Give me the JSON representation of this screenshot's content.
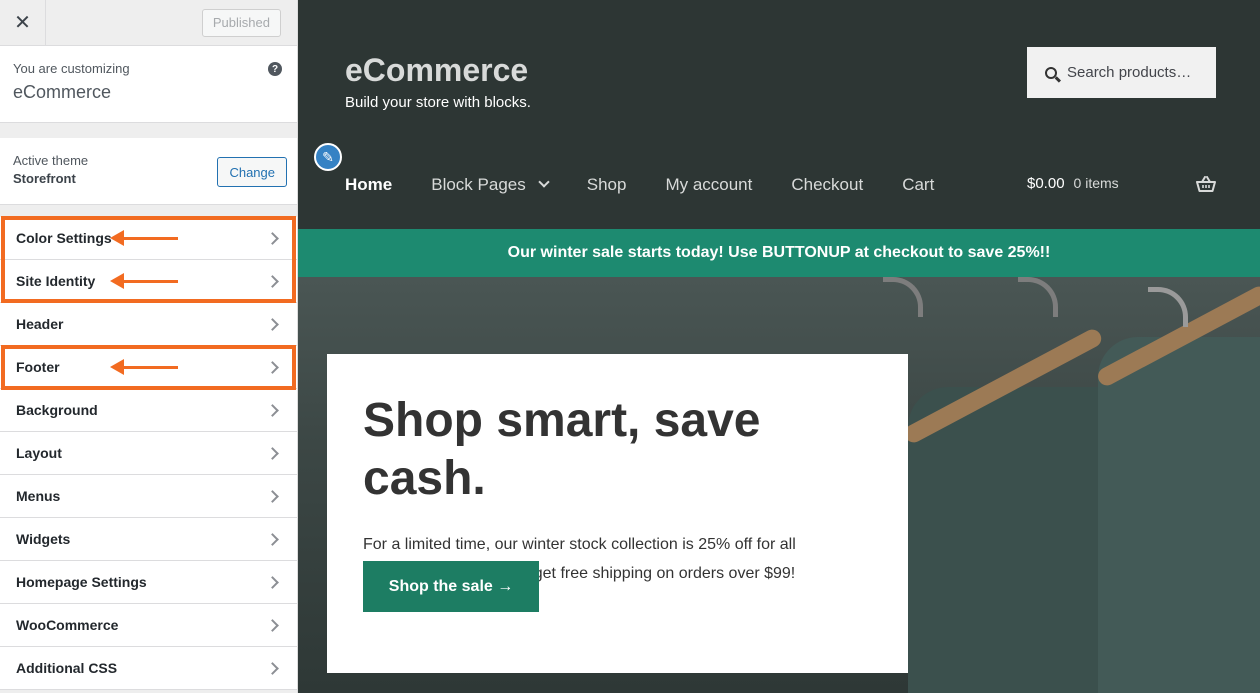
{
  "sidebar": {
    "close_icon": "close-icon",
    "publish_label": "Published",
    "customizing_label": "You are customizing",
    "site_name": "eCommerce",
    "help_icon": "?",
    "active_theme_label": "Active theme",
    "theme_name": "Storefront",
    "change_label": "Change",
    "panels": [
      {
        "label": "Color Settings",
        "highlighted": true
      },
      {
        "label": "Site Identity",
        "highlighted": true
      },
      {
        "label": "Header",
        "highlighted": false
      },
      {
        "label": "Footer",
        "highlighted": true
      },
      {
        "label": "Background",
        "highlighted": false
      },
      {
        "label": "Layout",
        "highlighted": false
      },
      {
        "label": "Menus",
        "highlighted": false
      },
      {
        "label": "Widgets",
        "highlighted": false
      },
      {
        "label": "Homepage Settings",
        "highlighted": false
      },
      {
        "label": "WooCommerce",
        "highlighted": false
      },
      {
        "label": "Additional CSS",
        "highlighted": false
      }
    ],
    "highlight_color": "#f26b21"
  },
  "preview": {
    "site_title": "eCommerce",
    "site_description": "Build your store with blocks.",
    "search_placeholder": "Search products…",
    "nav": [
      "Home",
      "Block Pages",
      "Shop",
      "My account",
      "Checkout",
      "Cart"
    ],
    "cart_amount": "$0.00",
    "cart_count": "0 items",
    "banner_text": "Our winter sale starts today! Use BUTTONUP at checkout to save 25%!!",
    "banner_color": "#1d8a70",
    "hero_title": "Shop smart, save cash.",
    "hero_text": "For a limited time, our winter stock collection is 25% off for all customers. As a bonus, get free shipping on orders over $99!",
    "hero_button": "Shop the sale →",
    "header_bg": "#2d3634"
  }
}
